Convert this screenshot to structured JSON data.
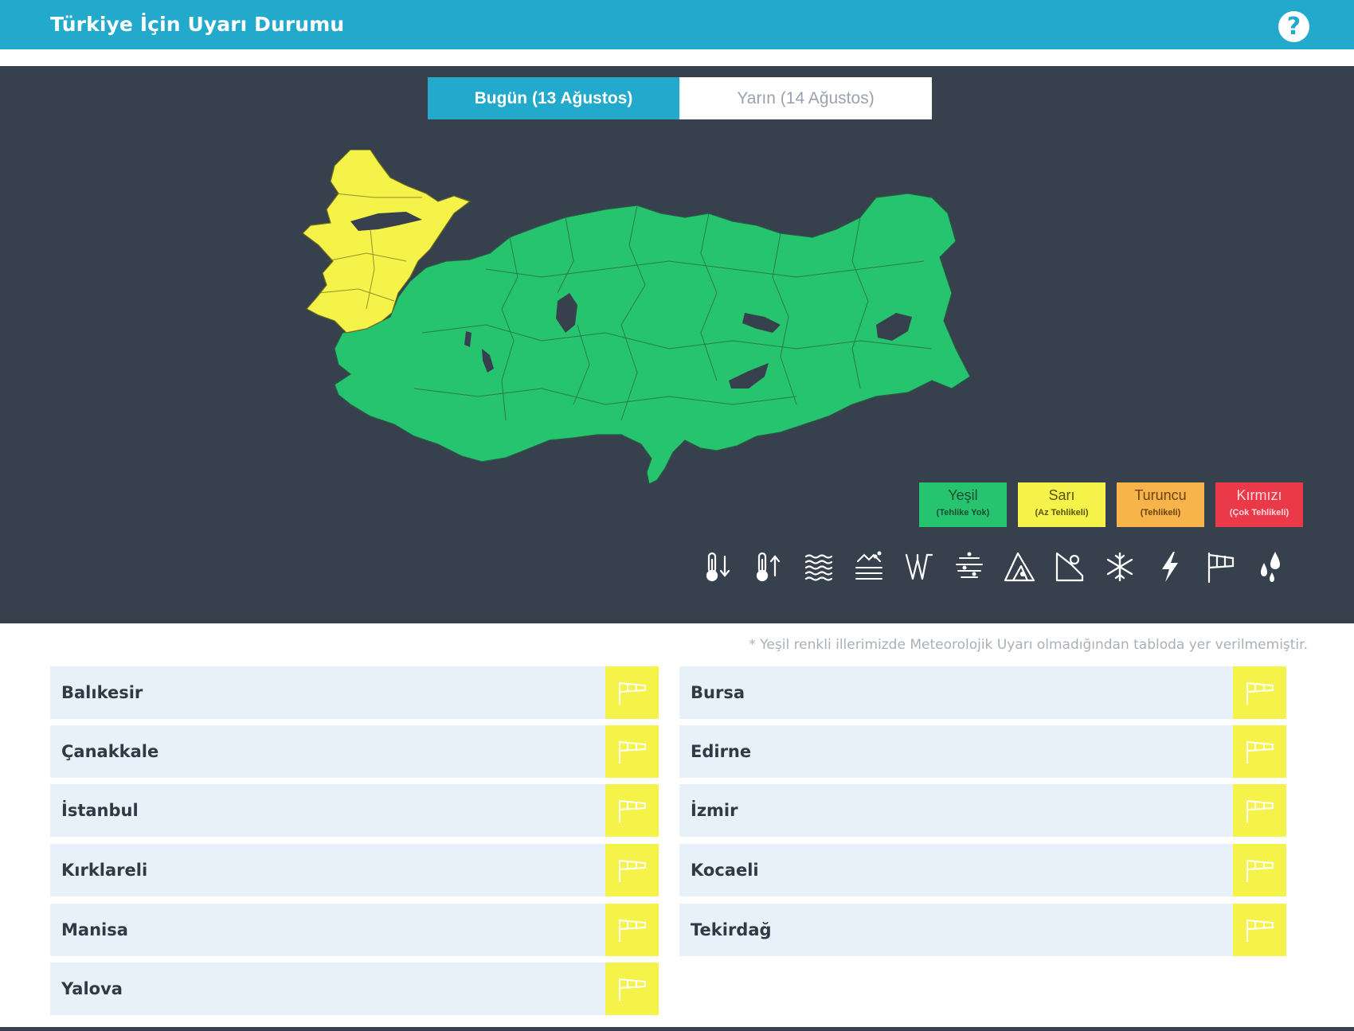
{
  "header": {
    "title": "Türkiye İçin Uyarı Durumu",
    "help_label": "?"
  },
  "tabs": {
    "today": "Bugün (13 Ağustos)",
    "tomorrow": "Yarın (14 Ağustos)"
  },
  "map": {
    "colors": {
      "west_region": "#f5f24a",
      "rest": "#27c46f",
      "border": "#2a3a36",
      "lakes": "#37414d"
    }
  },
  "legend": [
    {
      "name": "Yeşil",
      "desc": "(Tehlike Yok)",
      "color": "#27c46f"
    },
    {
      "name": "Sarı",
      "desc": "(Az Tehlikeli)",
      "color": "#f5f24a"
    },
    {
      "name": "Turuncu",
      "desc": "(Tehlikeli)",
      "color": "#f7b44a"
    },
    {
      "name": "Kırmızı",
      "desc": "(Çok Tehlikeli)",
      "color": "#ea3a4a"
    }
  ],
  "hazard_icons": [
    "low-temperature-icon",
    "high-temperature-icon",
    "fog-icon",
    "dust-icon",
    "hail-icon",
    "storm-icon",
    "avalanche-icon",
    "landslide-icon",
    "snow-icon",
    "lightning-icon",
    "wind-icon",
    "rain-icon"
  ],
  "note": "* Yeşil renkli illerimizde Meteorolojik Uyarı olmadığından tabloda yer verilmemiştir.",
  "provinces_left": [
    "Balıkesir",
    "Çanakkale",
    "İstanbul",
    "Kırklareli",
    "Manisa",
    "Yalova"
  ],
  "provinces_right": [
    "Bursa",
    "Edirne",
    "İzmir",
    "Kocaeli",
    "Tekirdağ"
  ],
  "warning_level_color": "#f5f24a",
  "warning_type_icon": "wind-icon"
}
